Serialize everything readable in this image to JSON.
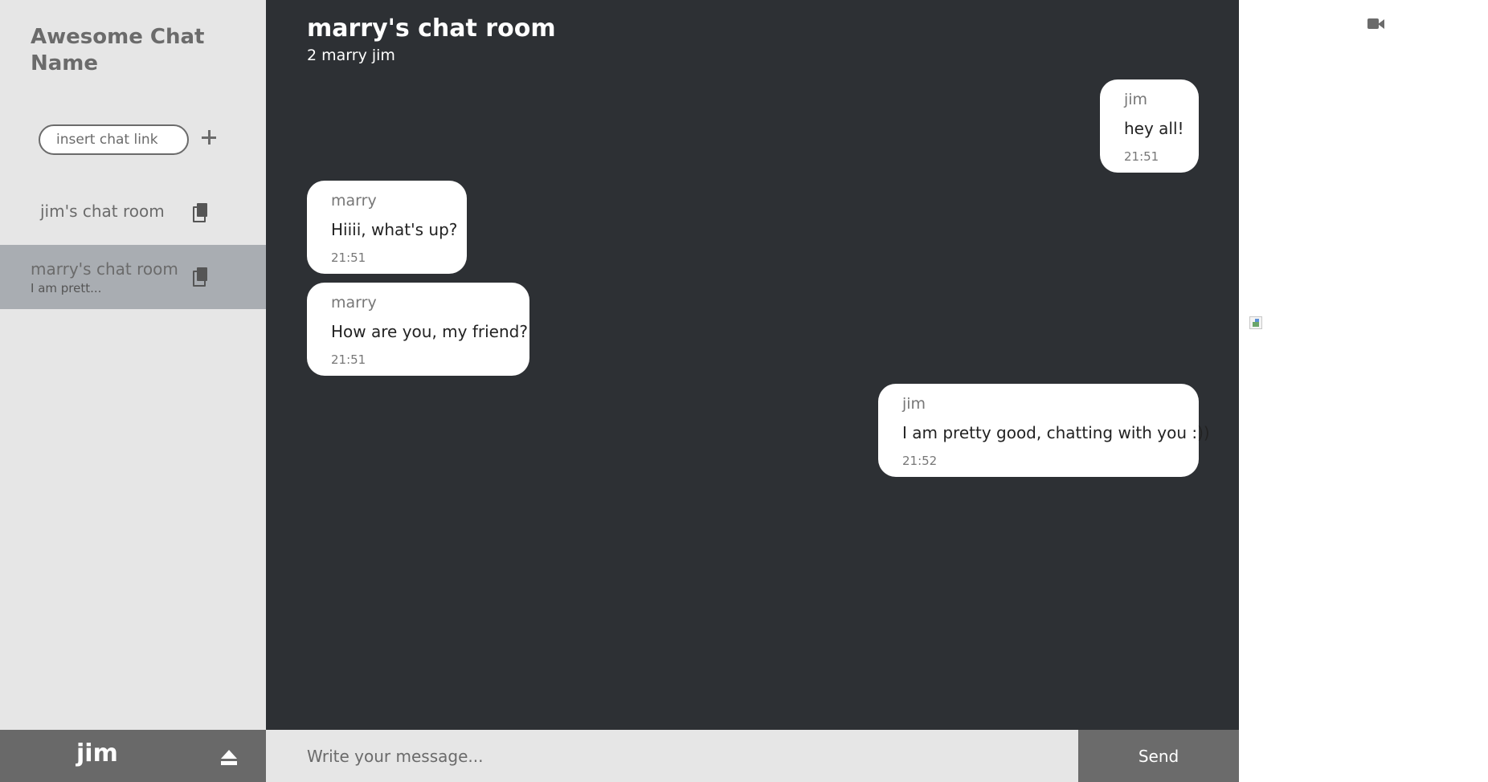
{
  "app": {
    "title": "Awesome Chat Name"
  },
  "sidebar": {
    "chat_link_placeholder": "insert chat link",
    "add_icon": "plus-icon",
    "rooms": [
      {
        "name": "jim's chat room",
        "preview": "",
        "active": false,
        "icon": "copy-icon"
      },
      {
        "name": "marry's chat room",
        "preview": "I am prett...",
        "active": true,
        "icon": "copy-icon"
      }
    ]
  },
  "user_bar": {
    "username": "jim",
    "logout_icon": "eject-icon"
  },
  "chat": {
    "title": "marry's chat room",
    "members": "2 marry jim",
    "messages": [
      {
        "author": "jim",
        "text": "hey all!",
        "time": "21:51",
        "side": "right"
      },
      {
        "author": "marry",
        "text": "Hiiii, what's up?",
        "time": "21:51",
        "side": "left"
      },
      {
        "author": "marry",
        "text": "How are you, my friend?",
        "time": "21:51",
        "side": "left"
      },
      {
        "author": "jim",
        "text": "I am pretty good, chatting with you :))",
        "time": "21:52",
        "side": "right"
      }
    ]
  },
  "composer": {
    "placeholder": "Write your message...",
    "send_label": "Send"
  },
  "right_panel": {
    "video_icon": "video-camera-icon",
    "image_icon": "broken-image-icon"
  },
  "colors": {
    "sidebar_bg": "#e6e6e6",
    "active_room_bg": "#a9adb2",
    "chat_bg": "#2d3034",
    "user_bar_bg": "#696969",
    "send_bg": "#6b6b6b",
    "bubble_bg": "#ffffff"
  }
}
